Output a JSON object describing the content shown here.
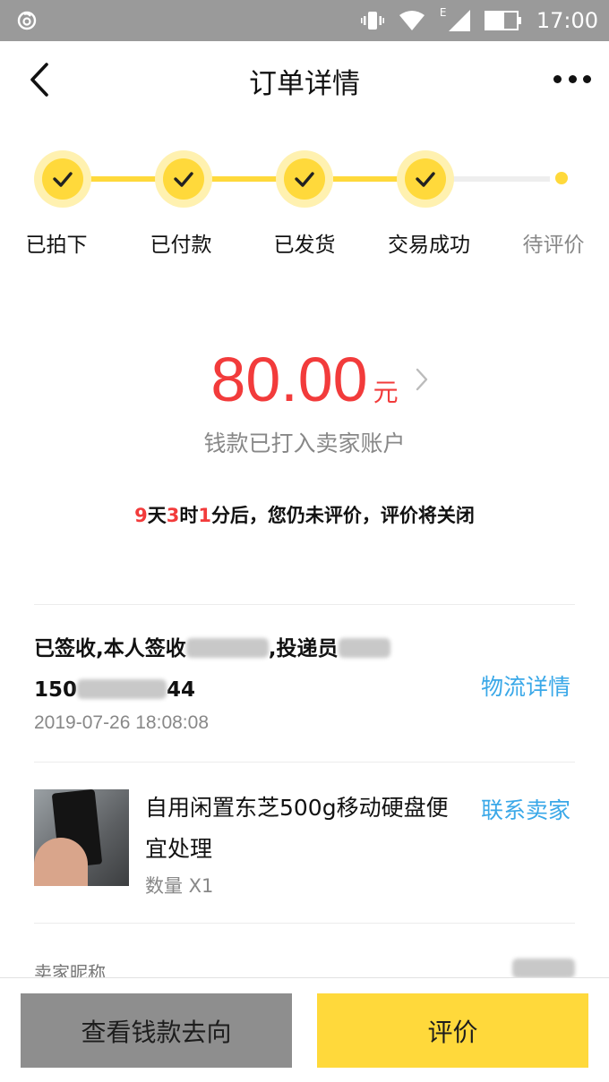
{
  "status_bar": {
    "time": "17:00",
    "network_label": "E",
    "icons": [
      "netease-icon",
      "vibrate-icon",
      "wifi-icon",
      "signal-icon",
      "battery-icon"
    ]
  },
  "header": {
    "title": "订单详情",
    "icons": [
      "back-arrow-icon",
      "more-dots-icon"
    ]
  },
  "steps": [
    {
      "label": "已拍下",
      "done": true
    },
    {
      "label": "已付款",
      "done": true
    },
    {
      "label": "已发货",
      "done": true
    },
    {
      "label": "交易成功",
      "done": true
    },
    {
      "label": "待评价",
      "done": false
    }
  ],
  "amount": {
    "value": "80.00",
    "unit": "元",
    "subtitle": "钱款已打入卖家账户"
  },
  "countdown": {
    "days": "9",
    "days_unit": "天",
    "hours": "3",
    "hours_unit": "时",
    "minutes": "1",
    "tail": "分后，您仍未评价，评价将关闭"
  },
  "logistics": {
    "line1_prefix": "已签收,本人签收",
    "line1_mid": ",投递员",
    "line2_prefix": "150",
    "line2_suffix": "44",
    "time": "2019-07-26 18:08:08",
    "link": "物流详情"
  },
  "product": {
    "title": "自用闲置东芝500g移动硬盘便宜处理",
    "quantity": "数量 X1",
    "link": "联系卖家"
  },
  "seller": {
    "label": "卖家昵称"
  },
  "actions": {
    "view_money": "查看钱款去向",
    "review": "评价"
  },
  "colors": {
    "accent_yellow": "#ffd93b",
    "price_red": "#f23b3b",
    "link_blue": "#3aa8e8"
  }
}
